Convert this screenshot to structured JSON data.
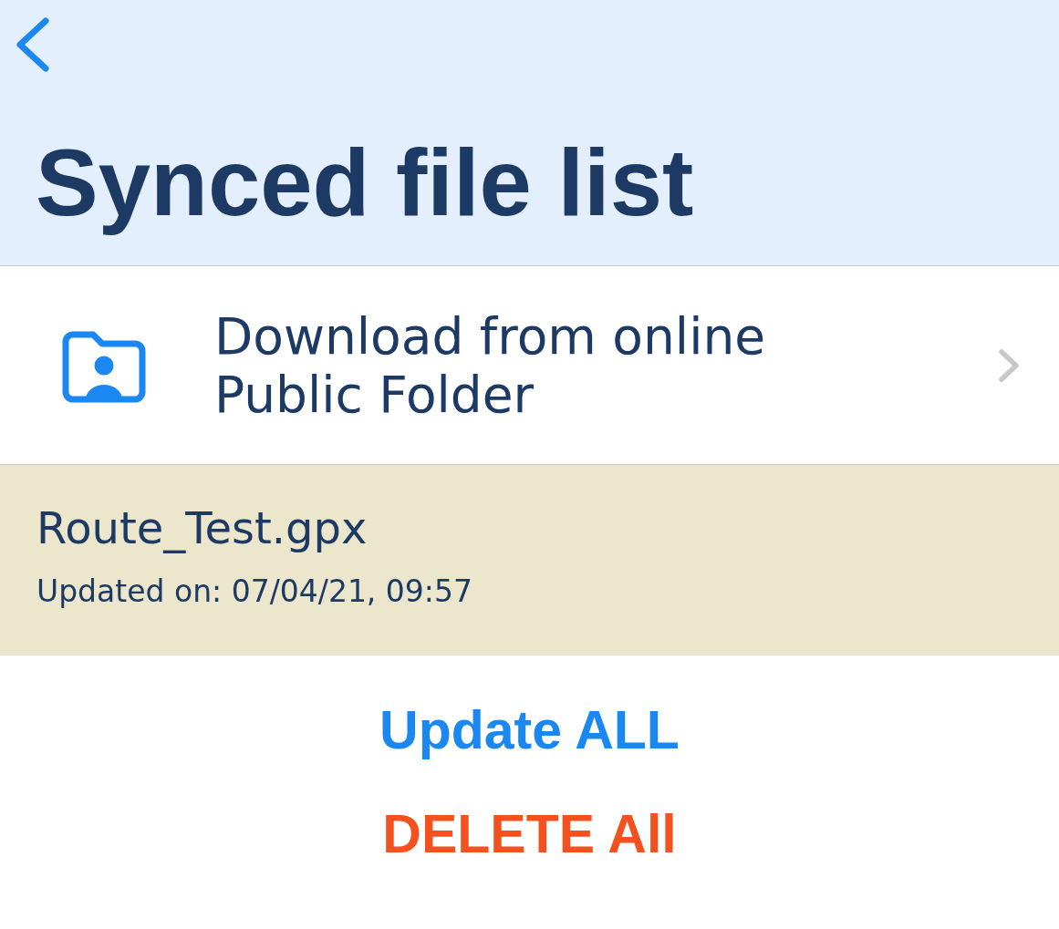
{
  "header": {
    "title": "Synced file list"
  },
  "public_folder_link": {
    "label": "Download from online Public Folder"
  },
  "files": [
    {
      "name": "Route_Test.gpx",
      "updated": "Updated on: 07/04/21, 09:57",
      "selected": true
    }
  ],
  "actions": [
    {
      "label": "Update ALL",
      "kind": "primary"
    },
    {
      "label": "DELETE All",
      "kind": "destructive"
    }
  ]
}
